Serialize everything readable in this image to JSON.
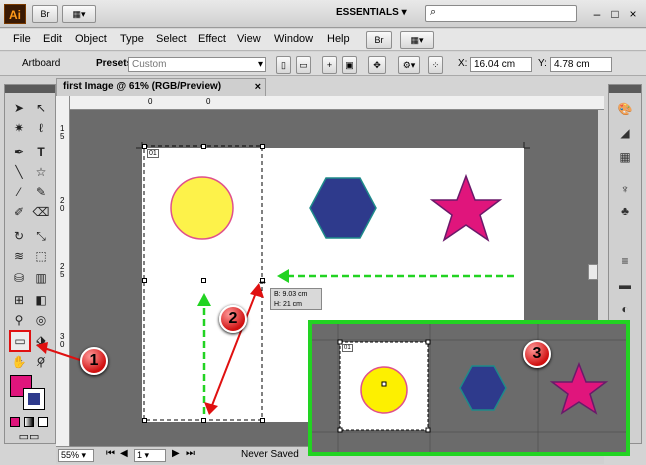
{
  "app": {
    "logo": "Ai",
    "bridge_label": "Br",
    "workspace": "ESSENTIALS",
    "search_placeholder": "",
    "window_controls": [
      "–",
      "□",
      "×"
    ]
  },
  "menu": [
    "File",
    "Edit",
    "Object",
    "Type",
    "Select",
    "Effect",
    "View",
    "Window",
    "Help"
  ],
  "control_bar": {
    "context": "Artboard",
    "presets_label": "Presets:",
    "presets_value": "Custom",
    "x_label": "X:",
    "x_value": "16.04 cm",
    "y_label": "Y:",
    "y_value": "4.78 cm"
  },
  "document": {
    "tab_title": "first Image @ 61% (RGB/Preview)",
    "ruler_top": [
      "0",
      "0"
    ],
    "ruler_left": [
      "1",
      "5",
      "2",
      "0",
      "2",
      "5",
      "3",
      "0"
    ],
    "artboard_number": "01",
    "inset_artboard_number": "01",
    "tooltip_line1": "B: 9.03 cm",
    "tooltip_line2": "H: 21 cm"
  },
  "status": {
    "zoom": "55%",
    "artboard_nav": "1",
    "save_state": "Never Saved"
  },
  "callouts": [
    "1",
    "2",
    "3"
  ],
  "colors": {
    "circle_fill": "#fdf24a",
    "circle_stroke": "#e0508c",
    "hexagon_fill": "#2e3a8c",
    "hexagon_stroke": "#1e8a8a",
    "star_fill": "#e0157c",
    "star_stroke": "#6a1a6a",
    "fill_swatch": "#e0157c",
    "guide_green": "#22d322",
    "arrow_red": "#e01010"
  },
  "icons": {
    "tools": [
      "selection-icon",
      "direct-selection-icon",
      "magic-wand-icon",
      "lasso-icon",
      "pen-icon",
      "type-icon",
      "line-icon",
      "rectangle-shape-icon",
      "paintbrush-icon",
      "pencil-icon",
      "blob-brush-icon",
      "eraser-icon",
      "rotate-icon",
      "scale-icon",
      "warp-icon",
      "free-transform-icon",
      "symbol-sprayer-icon",
      "column-graph-icon",
      "mesh-icon",
      "gradient-icon",
      "eyedropper-icon",
      "blend-icon",
      "live-paint-icon",
      "live-paint-selection-icon",
      "crop-icon",
      "slice-icon",
      "artboard-tool-icon",
      "scissors-icon",
      "hand-icon",
      "zoom-icon"
    ],
    "panels": [
      "color-icon",
      "color-guide-icon",
      "swatches-icon",
      "brushes-icon",
      "symbols-icon",
      "stroke-icon",
      "gradient-panel-icon",
      "transparency-icon",
      "appearance-icon",
      "graphic-styles-icon",
      "layers-icon"
    ]
  }
}
